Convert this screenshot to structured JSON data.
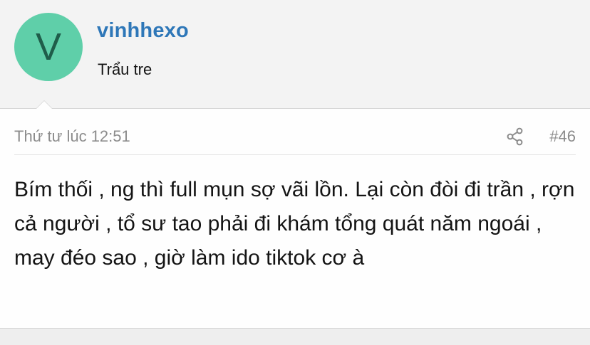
{
  "user": {
    "avatar_letter": "V",
    "avatar_color": "#5fcfa9",
    "name": "vinhhexo",
    "title": "Trẩu tre"
  },
  "post": {
    "timestamp": "Thứ tư lúc 12:51",
    "share_icon": "share-icon",
    "number": "#46",
    "body": "Bím thối , ng thì full mụn sợ vãi lồn. Lại còn đòi đi trần , rợn cả người , tổ sư tao phải đi khám tổng quát năm ngoái , may đéo sao , giờ làm ido tiktok cơ à"
  },
  "colors": {
    "username": "#2e77b8",
    "meta_text": "#8c8c8c",
    "background": "#f3f3f3",
    "card": "#fefefe"
  }
}
